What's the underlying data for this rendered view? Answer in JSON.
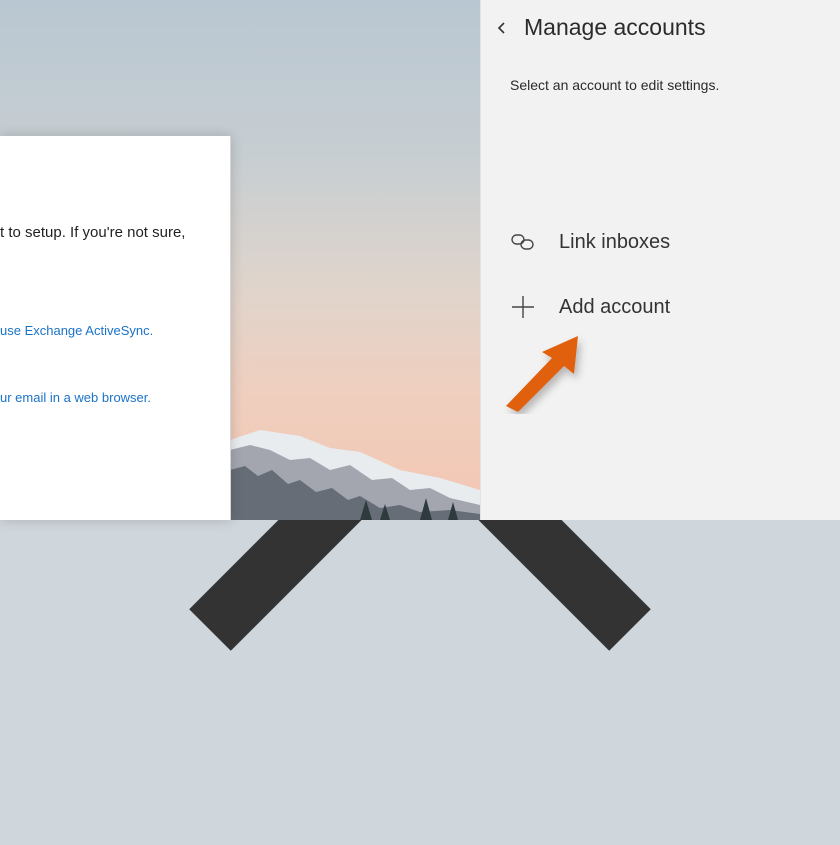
{
  "dialog": {
    "close_icon": "close-icon",
    "body_text": "t to setup. If you're not sure,",
    "link_exchange": "use Exchange ActiveSync.",
    "link_browser": "ur email in a web browser."
  },
  "panel": {
    "back_icon": "chevron-left-icon",
    "title": "Manage accounts",
    "subtitle": "Select an account to edit settings.",
    "items": [
      {
        "icon": "link-icon",
        "label": "Link inboxes"
      },
      {
        "icon": "plus-icon",
        "label": "Add account"
      }
    ]
  },
  "colors": {
    "link": "#1a73c9",
    "arrow": "#e0600f",
    "panel_bg": "#f2f2f2"
  }
}
